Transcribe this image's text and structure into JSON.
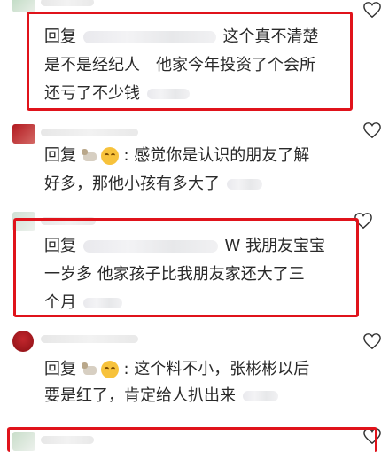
{
  "comments": [
    {
      "lines": [
        "回复",
        "这个真不清楚",
        "是不是经纪人　他家今年投资了个会所",
        "还亏了不少钱"
      ],
      "highlighted": true
    },
    {
      "lines": [
        "回复",
        ": 感觉你是认识的朋友了解",
        "好多，那他小孩有多大了"
      ],
      "highlighted": false
    },
    {
      "lines": [
        "回复",
        "W 我朋友宝宝",
        "一岁多 他家孩子比我朋友家还大了三",
        "个月"
      ],
      "highlighted": true
    },
    {
      "lines": [
        "回复",
        ": 这个料不小，张彬彬以后",
        "要是红了，肯定给人扒出来"
      ],
      "highlighted": false
    },
    {
      "lines": [],
      "highlighted": true
    }
  ],
  "icons": {
    "like": "heart-outline-icon",
    "reply_emoji": "grin-emoji-icon",
    "reply_avatar": "goat-icon"
  },
  "colors": {
    "highlight_border": "#e0131b",
    "text": "#2a2a2a",
    "heart_stroke": "#333333"
  }
}
